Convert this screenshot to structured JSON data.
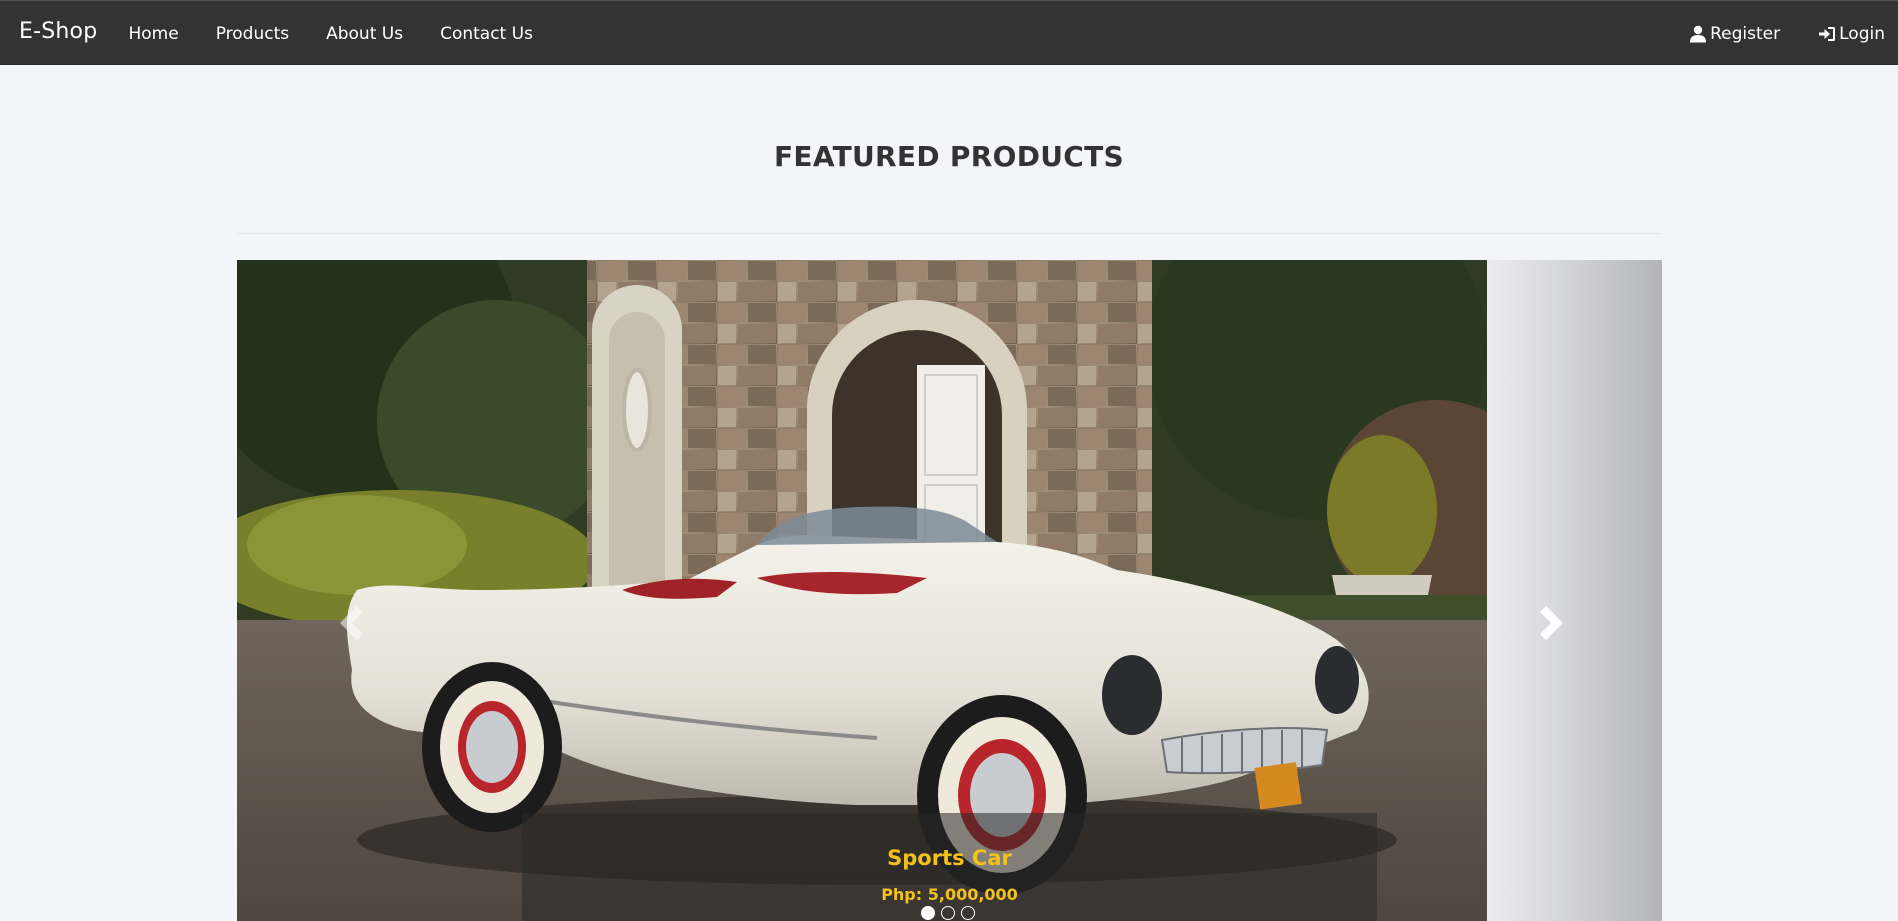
{
  "navbar": {
    "brand": "E-Shop",
    "links": [
      {
        "label": "Home"
      },
      {
        "label": "Products"
      },
      {
        "label": "About Us"
      },
      {
        "label": "Contact Us"
      }
    ],
    "right": {
      "register": {
        "label": "Register",
        "icon": "user-icon"
      },
      "login": {
        "label": "Login",
        "icon": "login-icon"
      }
    }
  },
  "main": {
    "title": "FEATURED PRODUCTS"
  },
  "carousel": {
    "active_index": 0,
    "slide_count": 3,
    "caption": {
      "title": "Sports Car",
      "price": "Php: 5,000,000"
    },
    "prev_icon": "chevron-left-icon",
    "next_icon": "chevron-right-icon",
    "caption_color": "#f3c119"
  },
  "colors": {
    "navbar_bg": "#333333",
    "page_bg": "#f4f5f9",
    "title_text": "#333333"
  }
}
